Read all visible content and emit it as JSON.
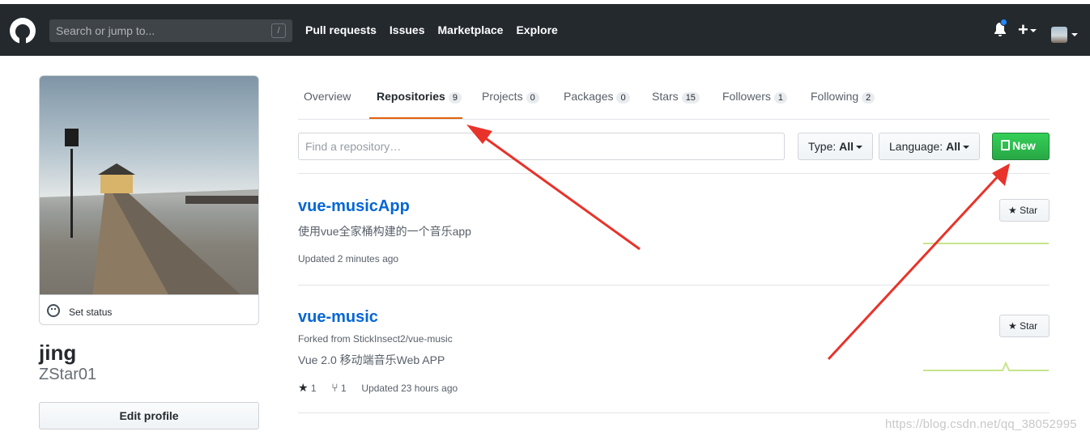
{
  "header": {
    "search_placeholder": "Search or jump to...",
    "search_shortcut": "/",
    "nav": [
      "Pull requests",
      "Issues",
      "Marketplace",
      "Explore"
    ],
    "plus": "+"
  },
  "profile": {
    "set_status": "Set status",
    "name": "jing",
    "username": "ZStar01",
    "edit_button": "Edit profile"
  },
  "tabs": [
    {
      "label": "Overview",
      "count": ""
    },
    {
      "label": "Repositories",
      "count": "9"
    },
    {
      "label": "Projects",
      "count": "0"
    },
    {
      "label": "Packages",
      "count": "0"
    },
    {
      "label": "Stars",
      "count": "15"
    },
    {
      "label": "Followers",
      "count": "1"
    },
    {
      "label": "Following",
      "count": "2"
    }
  ],
  "filters": {
    "find_placeholder": "Find a repository…",
    "type_label": "Type:",
    "type_value": "All",
    "language_label": "Language:",
    "language_value": "All",
    "new_button": "New"
  },
  "repos": [
    {
      "name": "vue-musicApp",
      "description": "使用vue全家桶构建的一个音乐app",
      "updated": "Updated 2 minutes ago",
      "star_button": "Star"
    },
    {
      "name": "vue-music",
      "forked_from": "Forked from StickInsect2/vue-music",
      "description": "Vue 2.0 移动端音乐Web APP",
      "stars": "1",
      "forks": "1",
      "updated": "Updated 23 hours ago",
      "star_button": "Star"
    }
  ],
  "watermark": "https://blog.csdn.net/qq_38052995",
  "colors": {
    "header_bg": "#24292e",
    "link": "#0366d6",
    "tab_active": "#e36209",
    "new_button": "#28a745",
    "annotation_arrow": "#e8332a"
  }
}
